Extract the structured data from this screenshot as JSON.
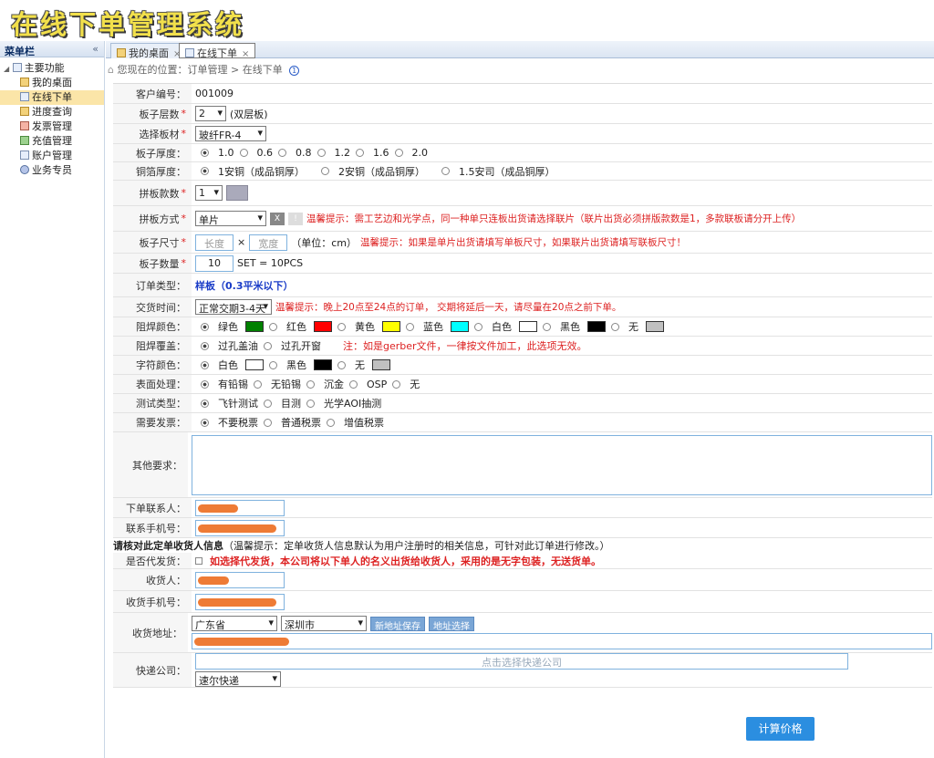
{
  "app_title": "在线下单管理系统",
  "sidebar": {
    "title": "菜单栏",
    "collapse": "«",
    "root": "主要功能",
    "items": [
      "我的桌面",
      "在线下单",
      "进度查询",
      "发票管理",
      "充值管理",
      "账户管理",
      "业务专员"
    ]
  },
  "tabs": [
    {
      "label": "我的桌面",
      "close": "×"
    },
    {
      "label": "在线下单",
      "close": "×"
    }
  ],
  "breadcrumb": "您现在的位置：订单管理 > 在线下单",
  "breadcrumb_info": "1",
  "form": {
    "customer_no": {
      "label": "客户编号：",
      "value": "001009"
    },
    "layers": {
      "label": "板子层数",
      "value": "2",
      "note": "(双层板)"
    },
    "material": {
      "label": "选择板材",
      "value": "玻纤FR-4"
    },
    "thickness": {
      "label": "板子厚度：",
      "options": [
        "1.0",
        "0.6",
        "0.8",
        "1.2",
        "1.6",
        "2.0"
      ]
    },
    "copper": {
      "label": "铜箔厚度：",
      "options": [
        "1安铜（成品铜厚）",
        "2安铜（成品铜厚）",
        "1.5安司（成品铜厚）"
      ]
    },
    "panel_count": {
      "label": "拼板款数",
      "value": "1"
    },
    "panel_mode": {
      "label": "拼板方式",
      "value": "单片",
      "btn1": "X",
      "btn2": "!",
      "tip": "温馨提示：需工艺边和光学点，同一种单只连板出货请选择联片（联片出货必须拼版款数是1，多款联板请分开上传）"
    },
    "size": {
      "label": "板子尺寸",
      "length_ph": "长度",
      "x": "×",
      "width_ph": "宽度",
      "unit": "（单位：cm）",
      "tip": "温馨提示：如果是单片出货请填写单板尺寸，如果联片出货请填写联板尺寸！"
    },
    "quantity": {
      "label": "板子数量",
      "value": "10",
      "note": "SET = 10PCS"
    },
    "order_type": {
      "label": "订单类型：",
      "value": "样板（0.3平米以下）"
    },
    "delivery": {
      "label": "交货时间：",
      "value": "正常交期3-4天",
      "tip": "温馨提示：晚上20点至24点的订单，  交期将延后一天，请尽量在20点之前下单。"
    },
    "mask_color": {
      "label": "阻焊颜色：",
      "options": [
        {
          "name": "绿色",
          "color": "#008000"
        },
        {
          "name": "红色",
          "color": "#ff0000"
        },
        {
          "name": "黄色",
          "color": "#ffff00"
        },
        {
          "name": "蓝色",
          "color": "#00ffff"
        },
        {
          "name": "白色",
          "color": "#ffffff"
        },
        {
          "name": "黑色",
          "color": "#000000"
        },
        {
          "name": "无",
          "color": "#c0c0c0"
        }
      ]
    },
    "mask_cover": {
      "label": "阻焊覆盖：",
      "options": [
        "过孔盖油",
        "过孔开窗"
      ],
      "tip": "注：如是gerber文件，一律按文件加工，此选项无效。"
    },
    "silk_color": {
      "label": "字符颜色：",
      "options": [
        {
          "name": "白色",
          "color": "#ffffff"
        },
        {
          "name": "黑色",
          "color": "#000000"
        },
        {
          "name": "无",
          "color": "#c0c0c0"
        }
      ]
    },
    "surface": {
      "label": "表面处理：",
      "options": [
        "有铅锡",
        "无铅锡",
        "沉金",
        "OSP",
        "无"
      ]
    },
    "test": {
      "label": "测试类型：",
      "options": [
        "飞针测试",
        "目测",
        "光学AOI抽测"
      ]
    },
    "invoice": {
      "label": "需要发票：",
      "options": [
        "不要税票",
        "普通税票",
        "增值税票"
      ]
    },
    "other": {
      "label": "其他要求："
    },
    "contact": {
      "label": "下单联系人："
    },
    "phone": {
      "label": "联系手机号："
    },
    "receiver_note_bold": "请核对此定单收货人信息",
    "receiver_note": "（温馨提示：定单收货人信息默认为用户注册时的相关信息，可针对此订单进行修改。）",
    "proxy": {
      "label": "是否代发货：",
      "tip": "如选择代发货，本公司将以下单人的名义出货给收货人，采用的是无字包装，无送货单。"
    },
    "receiver": {
      "label": "收货人："
    },
    "receiver_phone": {
      "label": "收货手机号："
    },
    "address": {
      "label": "收货地址：",
      "province": "广东省",
      "city": "深圳市",
      "save_btn": "新地址保存",
      "select_btn": "地址选择"
    },
    "express": {
      "label": "快递公司：",
      "placeholder": "点击选择快递公司",
      "value": "速尔快递"
    }
  },
  "calc_button": "计算价格"
}
